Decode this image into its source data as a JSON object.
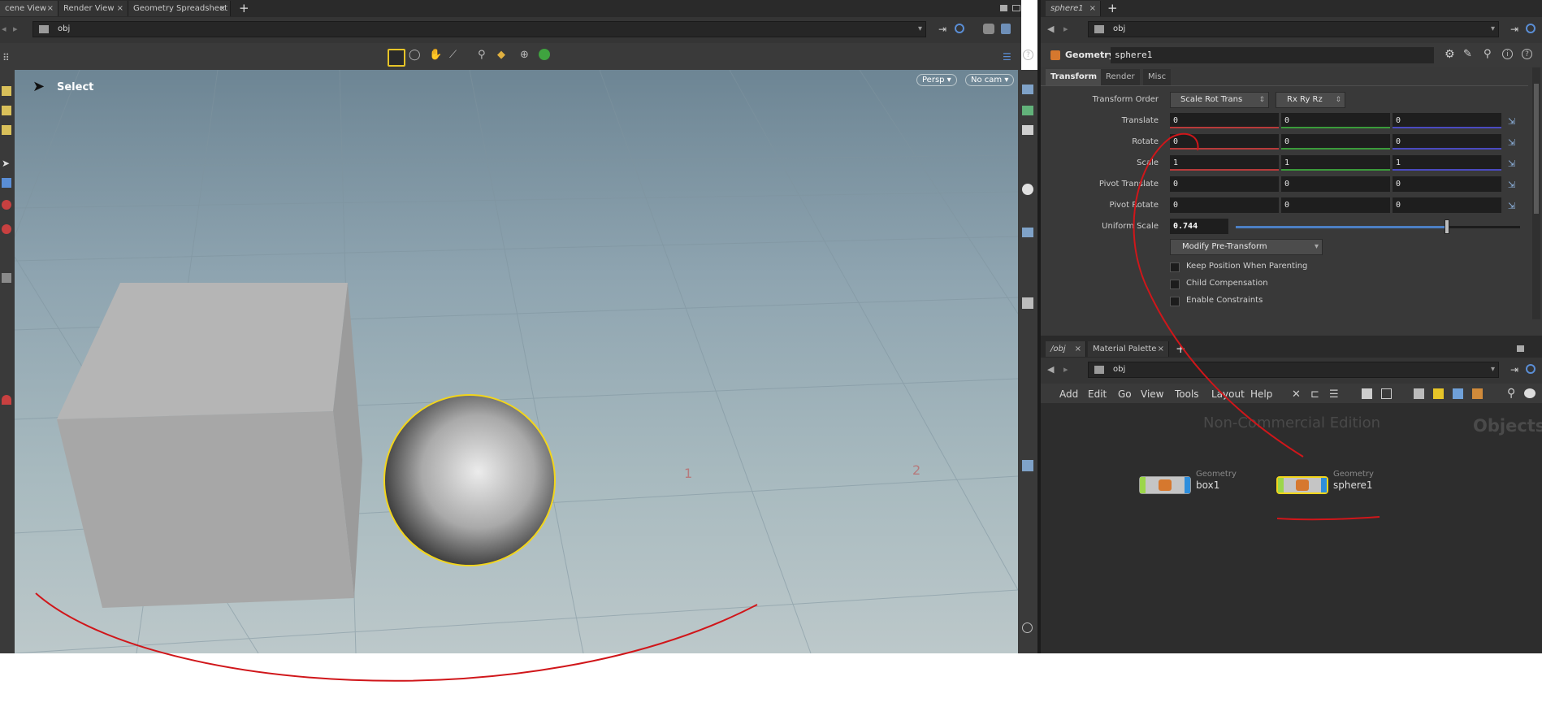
{
  "left_pane": {
    "tabs": [
      {
        "label": "cene View"
      },
      {
        "label": "Render View"
      },
      {
        "label": "Geometry Spreadsheet"
      }
    ],
    "tab_close": "×",
    "add_tab": "+",
    "path": "obj",
    "select_hint": "Select",
    "viewport": {
      "persp_button": "Persp ▾",
      "cam_button": "No cam ▾",
      "grid_labels": [
        "1",
        "2"
      ]
    }
  },
  "param_pane": {
    "tab_label": "sphere1",
    "tab_close": "×",
    "add_tab": "+",
    "path": "obj",
    "node_type": "Geometry",
    "node_name": "sphere1",
    "subtabs": [
      "Transform",
      "Render",
      "Misc"
    ],
    "transform_order": {
      "label": "Transform Order",
      "value1": "Scale Rot Trans",
      "value2": "Rx Ry Rz"
    },
    "rows": [
      {
        "label": "Translate",
        "values": [
          "0",
          "0",
          "0"
        ]
      },
      {
        "label": "Rotate",
        "values": [
          "0",
          "0",
          "0"
        ]
      },
      {
        "label": "Scale",
        "values": [
          "1",
          "1",
          "1"
        ]
      },
      {
        "label": "Pivot Translate",
        "values": [
          "0",
          "0",
          "0"
        ]
      },
      {
        "label": "Pivot Rotate",
        "values": [
          "0",
          "0",
          "0"
        ]
      }
    ],
    "uniform_scale": {
      "label": "Uniform Scale",
      "value": "0.744",
      "slider_fraction": 0.744
    },
    "modify_button": "Modify Pre-Transform",
    "checkboxes": [
      {
        "label": "Keep Position When Parenting"
      },
      {
        "label": "Child Compensation"
      },
      {
        "label": "Enable Constraints"
      }
    ]
  },
  "network_pane": {
    "tabs": [
      {
        "label": "/obj"
      },
      {
        "label": "Material Palette"
      }
    ],
    "tab_close": "×",
    "add_tab": "+",
    "path": "obj",
    "menu": [
      "Add",
      "Edit",
      "Go",
      "View",
      "Tools",
      "Layout",
      "Help"
    ],
    "watermark": "Non-Commercial Edition",
    "context_label": "Objects",
    "nodes": [
      {
        "type": "Geometry",
        "name": "box1"
      },
      {
        "type": "Geometry",
        "name": "sphere1"
      }
    ]
  },
  "colors": {
    "annotation": "#d0161a",
    "selection": "#f2d51b",
    "panel_bg": "#393939",
    "field_bg": "#1e1e1e"
  }
}
